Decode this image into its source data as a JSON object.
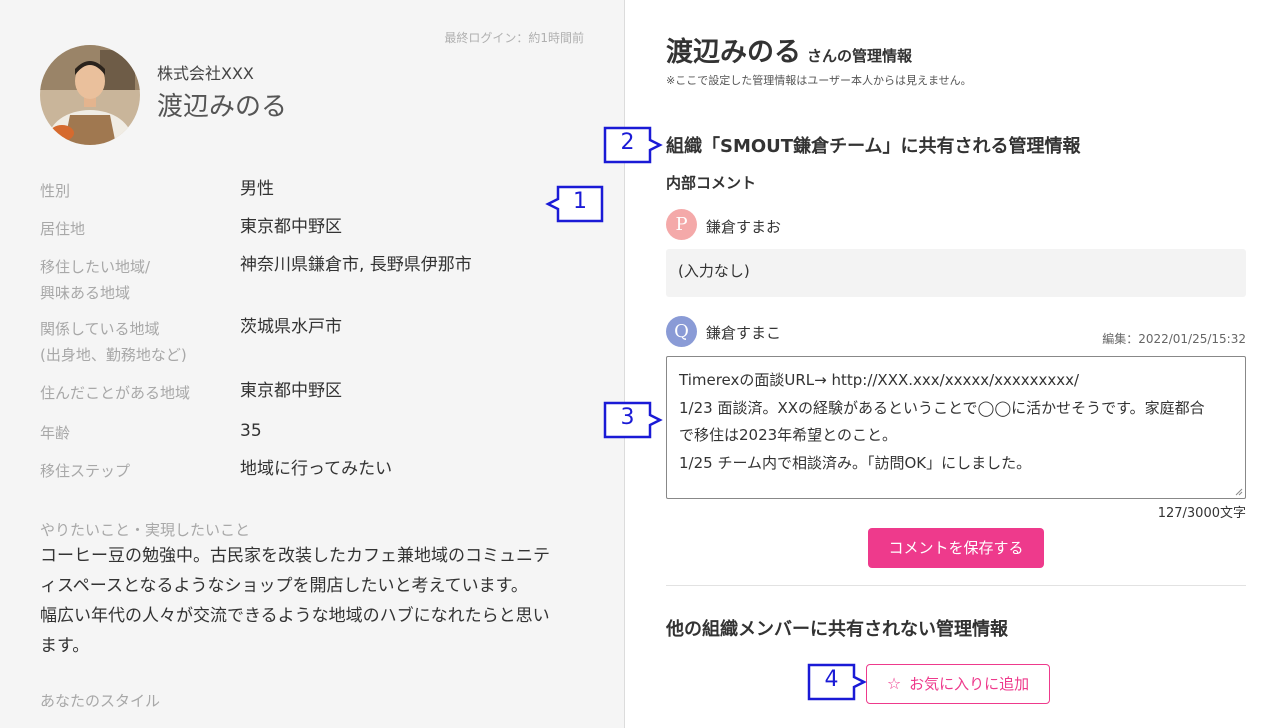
{
  "profile": {
    "last_login": "最終ログイン：約1時間前",
    "company": "株式会社XXX",
    "name": "渡辺みのる",
    "fields": [
      {
        "label": "性別",
        "value": "男性"
      },
      {
        "label": "居住地",
        "value": "東京都中野区"
      },
      {
        "label": "移住したい地域/",
        "label2": "興味ある地域",
        "value": "神奈川県鎌倉市, 長野県伊那市"
      },
      {
        "label": "関係している地域",
        "label2": "(出身地、勤務地など)",
        "value": "茨城県水戸市"
      },
      {
        "label": "住んだことがある地域",
        "value": "東京都中野区"
      },
      {
        "label": "年齢",
        "value": "35"
      },
      {
        "label": "移住ステップ",
        "value": "地域に行ってみたい"
      }
    ],
    "goals_label": "やりたいこと・実現したいこと",
    "goals_lines": [
      "コーヒー豆の勉強中。古民家を改装したカフェ兼地域のコミュニテ",
      "ィスペースとなるようなショップを開店したいと考えています。",
      "幅広い年代の人々が交流できるような地域のハブになれたらと思い",
      "ます。"
    ],
    "style_label": "あなたのスタイル"
  },
  "admin": {
    "title_name": "渡辺みのる",
    "title_suffix": "さんの管理情報",
    "note": "※ここで設定した管理情報はユーザー本人からは見えません。",
    "shared_heading": "組織「SMOUT鎌倉チーム」に共有される管理情報",
    "internal_comment_label": "内部コメント",
    "comments": [
      {
        "avatar_letter": "P",
        "avatar_color": "#f4a9a9",
        "author": "鎌倉すまお",
        "text": "(入力なし)"
      },
      {
        "avatar_letter": "Q",
        "avatar_color": "#8a9bd6",
        "author": "鎌倉すまこ",
        "edited": "編集：2022/01/25/15:32",
        "lines": [
          "Timerexの面談URL→ http://XXX.xxx/xxxxx/xxxxxxxxx/",
          "1/23 面談済。XXの経験があるということで◯◯に活かせそうです。家庭都合",
          "で移住は2023年希望とのこと。",
          "1/25 チーム内で相談済み。「訪問OK」にしました。"
        ]
      }
    ],
    "char_count": "127/3000文字",
    "save_button": "コメントを保存する",
    "private_heading": "他の組織メンバーに共有されない管理情報",
    "favorite_button": "お気に入りに追加",
    "accent_color": "#ee3a8c"
  },
  "callouts": [
    "1",
    "2",
    "3",
    "4"
  ]
}
